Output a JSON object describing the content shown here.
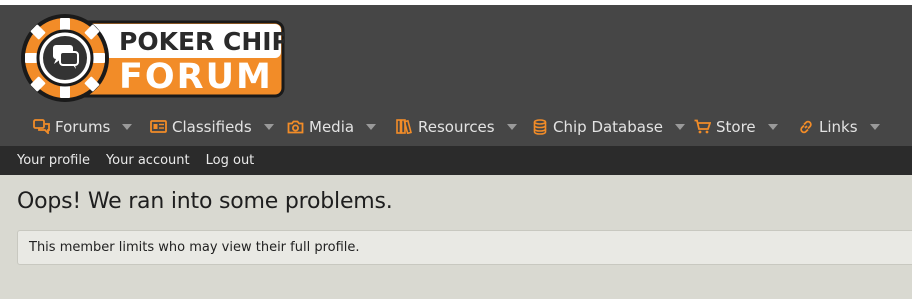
{
  "logo": {
    "line1": "POKER CHIP",
    "line2": "FORUM"
  },
  "nav": {
    "items": [
      {
        "label": "Forums",
        "icon": "chat-bubbles-icon"
      },
      {
        "label": "Classifieds",
        "icon": "newspaper-icon"
      },
      {
        "label": "Media",
        "icon": "camera-icon"
      },
      {
        "label": "Resources",
        "icon": "books-icon"
      },
      {
        "label": "Chip Database",
        "icon": "database-icon"
      },
      {
        "label": "Store",
        "icon": "cart-icon"
      },
      {
        "label": "Links",
        "icon": "link-icon"
      }
    ]
  },
  "subnav": {
    "profile": "Your profile",
    "account": "Your account",
    "logout": "Log out"
  },
  "page": {
    "title": "Oops! We ran into some problems.",
    "message": "This member limits who may view their full profile."
  },
  "colors": {
    "accent": "#f28c28",
    "header_bg": "#464646",
    "subnav_bg": "#2b2b2b",
    "page_bg": "#d9d9d1"
  }
}
